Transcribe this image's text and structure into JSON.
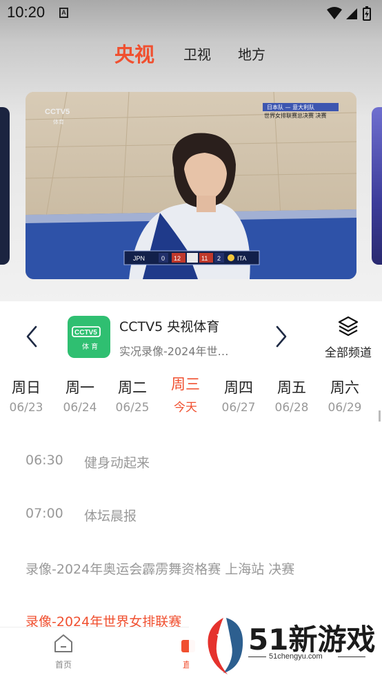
{
  "status_bar": {
    "time": "10:20",
    "app_badge": "A"
  },
  "top_tabs": [
    {
      "label": "央视",
      "active": true
    },
    {
      "label": "卫视",
      "active": false
    },
    {
      "label": "地方",
      "active": false
    }
  ],
  "hero": {
    "channel_mark": "CCTV5",
    "channel_mark_sub": "体育",
    "caption_line1": "日本队 — 意大利队",
    "caption_line2": "世界女排联赛总决赛 决赛",
    "score": {
      "team_a": "JPN",
      "sets_a": "0",
      "points_a": "12",
      "points_b": "11",
      "sets_b": "2",
      "team_b": "ITA"
    }
  },
  "channel": {
    "logo_text": "CCTV5",
    "logo_sub": "体 育",
    "name": "CCTV5 央视体育",
    "now_playing": "实况录像-2024年世…",
    "all_channels_label": "全部频道"
  },
  "days": [
    {
      "name": "周日",
      "date": "06/23",
      "active": false
    },
    {
      "name": "周一",
      "date": "06/24",
      "active": false
    },
    {
      "name": "周二",
      "date": "06/25",
      "active": false
    },
    {
      "name": "周三",
      "date": "今天",
      "active": true
    },
    {
      "name": "周四",
      "date": "06/27",
      "active": false
    },
    {
      "name": "周五",
      "date": "06/28",
      "active": false
    },
    {
      "name": "周六",
      "date": "06/29",
      "active": false
    }
  ],
  "schedule": [
    {
      "time": "06:30",
      "title": "健身动起来"
    },
    {
      "time": "07:00",
      "title": "体坛晨报"
    },
    {
      "time": "",
      "title": "录像-2024年奥运会霹雳舞资格赛 上海站 决赛"
    },
    {
      "time": "",
      "title": "录像-2024年世界女排联赛"
    }
  ],
  "bottom_nav": [
    {
      "label": "首页"
    },
    {
      "label": "直"
    }
  ],
  "watermark": {
    "text": "51新游戏",
    "url": "51chengyu.com"
  },
  "colors": {
    "accent": "#f05030",
    "logo_green": "#2fbf71"
  }
}
